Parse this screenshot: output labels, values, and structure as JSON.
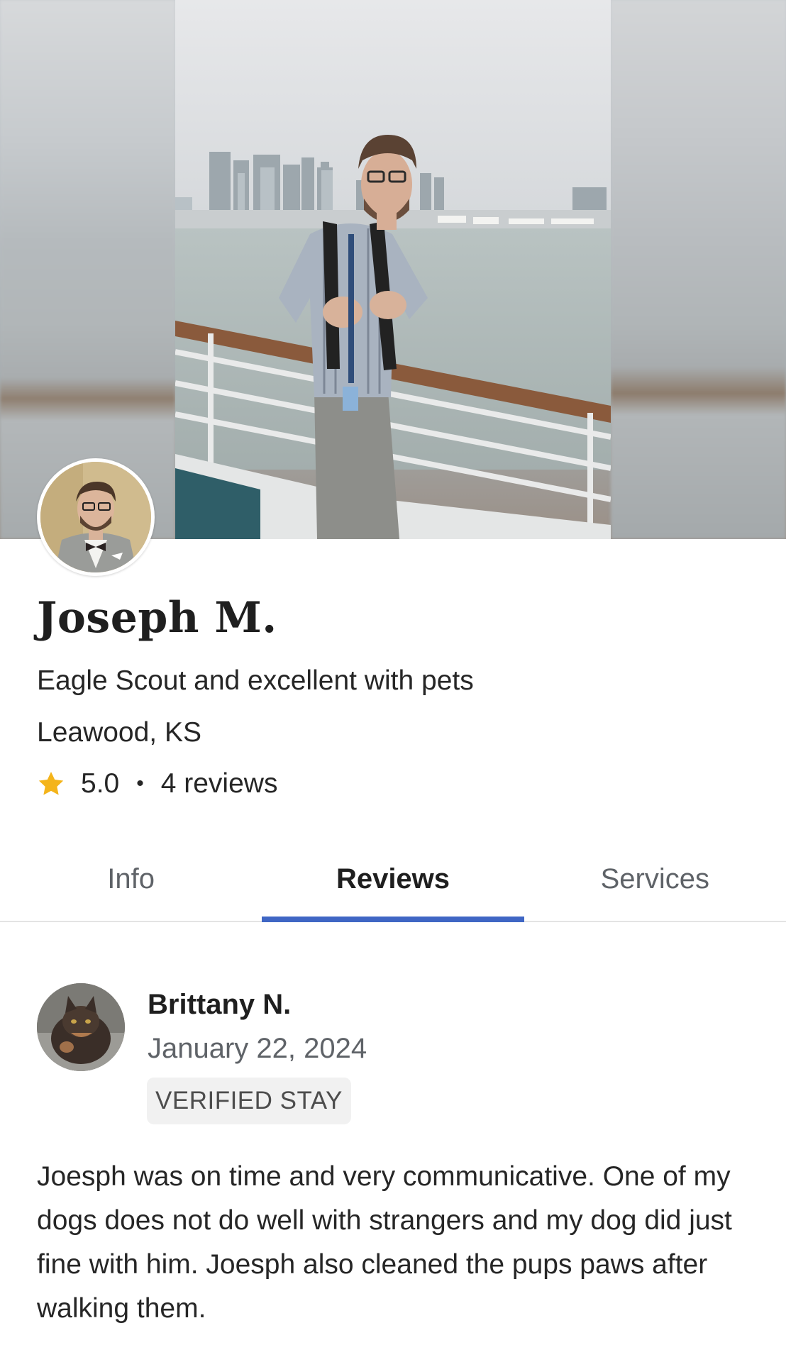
{
  "profile": {
    "name": "Joseph M.",
    "tagline": "Eagle Scout and excellent with pets",
    "location": "Leawood, KS",
    "rating": "5.0",
    "rating_separator": "•",
    "reviews_count": "4 reviews",
    "avatar_icon": "person-photo",
    "cover_icon": "person-on-ship-deck-photo"
  },
  "tabs": [
    {
      "label": "Info",
      "active": false
    },
    {
      "label": "Reviews",
      "active": true
    },
    {
      "label": "Services",
      "active": false
    }
  ],
  "review": {
    "reviewer_name": "Brittany N.",
    "date": "January 22, 2024",
    "badge": "VERIFIED STAY",
    "body": "Joesph was on time and very communicative. One of my dogs does not do well with strangers and my dog did just fine with him. Joesph also cleaned the pups paws after walking them.",
    "avatar_icon": "cat-photo"
  },
  "colors": {
    "accent": "#3f66c4",
    "star": "#f4b41a",
    "text_primary": "#1f1f1f",
    "text_secondary": "#5f6368",
    "badge_bg": "#f1f1f1"
  }
}
